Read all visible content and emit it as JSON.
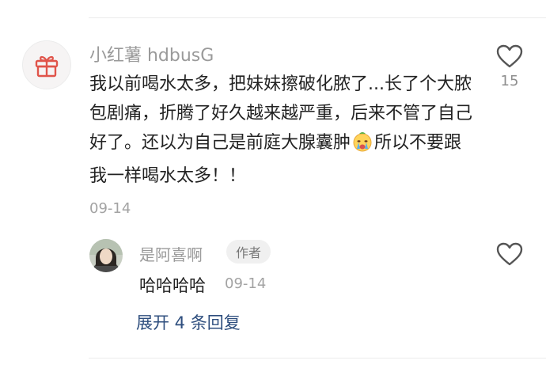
{
  "comment": {
    "author": "小红薯 hdbusG",
    "text_before_emoji": "我以前喝水太多，把妹妹擦破化脓了...长了个大脓包剧痛，折腾了好久越来越严重，后来不管了自己好了。还以为自己是前庭大腺囊肿",
    "text_after_emoji": "所以不要跟我一样喝水太多！！",
    "date": "09-14",
    "like_count": "15",
    "avatar_icon": "gift-icon",
    "emoji_icon": "crying-face-icon",
    "like_icon": "heart-outline-icon"
  },
  "reply": {
    "author": "是阿喜啊",
    "badge": "作者",
    "text": "哈哈哈哈",
    "date": "09-14",
    "like_icon": "heart-outline-icon"
  },
  "expand_replies": "展开 4 条回复",
  "colors": {
    "secondary_text": "#9a9a9a",
    "link": "#2e4e7e",
    "gift_red": "#e0544a"
  }
}
